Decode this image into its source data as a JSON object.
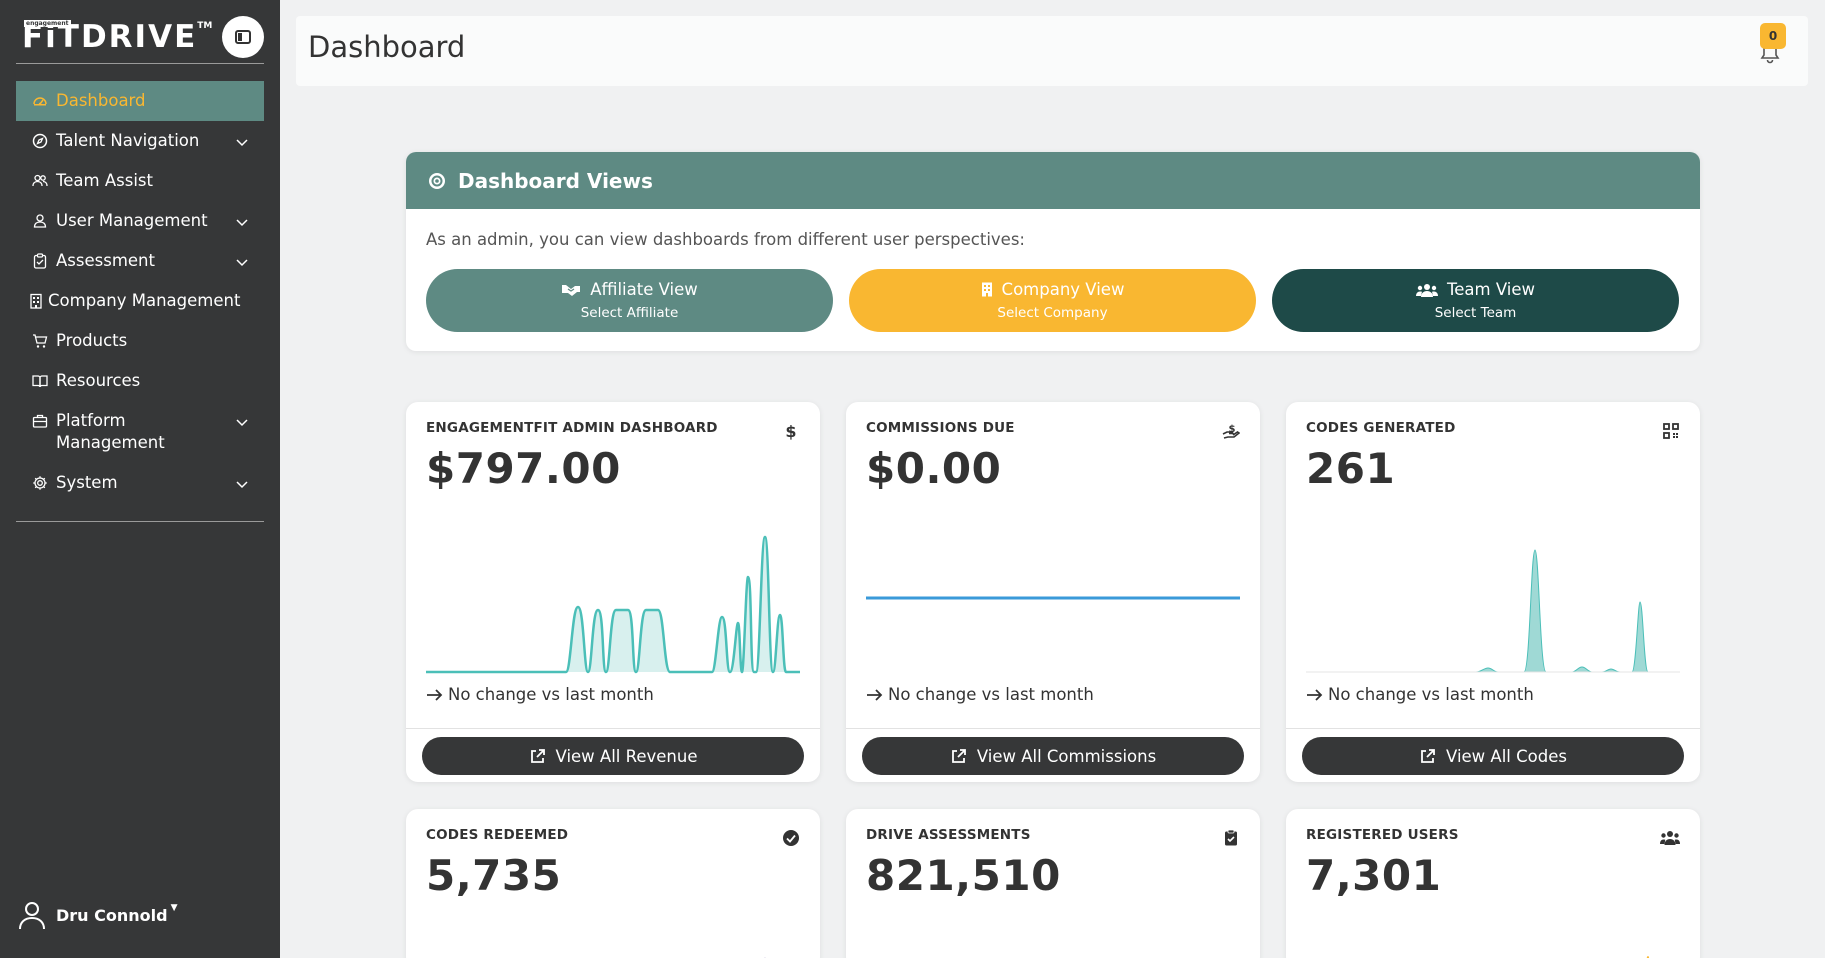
{
  "app": {
    "logo_small": "engagement",
    "logo_main": "FiTDRIVE",
    "logo_tm": "TM"
  },
  "sidebar": {
    "items": [
      {
        "label": "Dashboard",
        "icon": "gauge-icon",
        "active": true,
        "expandable": false
      },
      {
        "label": "Talent Navigation",
        "icon": "compass-icon",
        "active": false,
        "expandable": true
      },
      {
        "label": "Team Assist",
        "icon": "users-icon",
        "active": false,
        "expandable": false
      },
      {
        "label": "User Management",
        "icon": "user-icon",
        "active": false,
        "expandable": true
      },
      {
        "label": "Assessment",
        "icon": "clipboard-icon",
        "active": false,
        "expandable": true
      },
      {
        "label": "Company Management",
        "icon": "building-icon",
        "active": false,
        "expandable": false
      },
      {
        "label": "Products",
        "icon": "cart-icon",
        "active": false,
        "expandable": false
      },
      {
        "label": "Resources",
        "icon": "book-icon",
        "active": false,
        "expandable": false
      },
      {
        "label": "Platform Management",
        "icon": "briefcase-icon",
        "active": false,
        "expandable": true
      },
      {
        "label": "System",
        "icon": "gear-icon",
        "active": false,
        "expandable": true
      }
    ],
    "user_name": "Dru Connold"
  },
  "header": {
    "title": "Dashboard",
    "notification_count": "0"
  },
  "views": {
    "title": "Dashboard Views",
    "description": "As an admin, you can view dashboards from different user perspectives:",
    "buttons": [
      {
        "label": "Affiliate View",
        "sub": "Select Affiliate"
      },
      {
        "label": "Company View",
        "sub": "Select Company"
      },
      {
        "label": "Team View",
        "sub": "Select Team"
      }
    ]
  },
  "colors": {
    "sidebar_bg": "#363738",
    "accent_teal": "#5e8a83",
    "accent_yellow": "#f9b731",
    "accent_dark_teal": "#1e4a48",
    "spark_teal": "#4bbfb8",
    "spark_blue": "#3a9ad9"
  },
  "cards": [
    {
      "label": "ENGAGEMENTFIT ADMIN DASHBOARD",
      "icon": "dollar-icon",
      "value": "$797.00",
      "change": "No change vs last month",
      "button": "View All Revenue"
    },
    {
      "label": "COMMISSIONS DUE",
      "icon": "hand-dollar-icon",
      "value": "$0.00",
      "change": "No change vs last month",
      "button": "View All Commissions"
    },
    {
      "label": "CODES GENERATED",
      "icon": "qrcode-icon",
      "value": "261",
      "change": "No change vs last month",
      "button": "View All Codes"
    },
    {
      "label": "CODES REDEEMED",
      "icon": "check-circle-icon",
      "value": "5,735",
      "change": "",
      "button": ""
    },
    {
      "label": "DRIVE ASSESSMENTS",
      "icon": "clipboard-check-icon",
      "value": "821,510",
      "change": "",
      "button": ""
    },
    {
      "label": "REGISTERED USERS",
      "icon": "users-icon",
      "value": "7,301",
      "change": "",
      "button": ""
    }
  ]
}
